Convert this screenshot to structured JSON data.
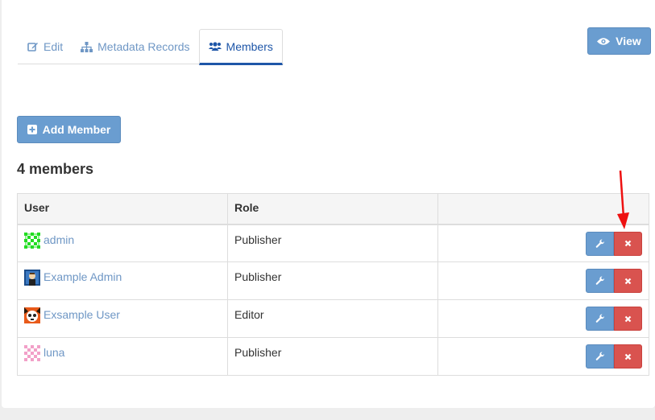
{
  "tabs": [
    {
      "label": "Edit",
      "icon": "edit-icon",
      "active": false
    },
    {
      "label": "Metadata Records",
      "icon": "sitemap-icon",
      "active": false
    },
    {
      "label": "Members",
      "icon": "users-icon",
      "active": true
    }
  ],
  "view_button": {
    "label": "View",
    "icon": "eye-icon"
  },
  "add_member_button": {
    "label": "Add Member",
    "icon": "plus-square-icon"
  },
  "member_count": "4 members",
  "table": {
    "headers": [
      "User",
      "Role",
      ""
    ],
    "rows": [
      {
        "user": "admin",
        "role": "Publisher",
        "avatar": "green-identicon"
      },
      {
        "user": "Example Admin",
        "role": "Publisher",
        "avatar": "person-avatar"
      },
      {
        "user": "Exsample User",
        "role": "Editor",
        "avatar": "panda-avatar"
      },
      {
        "user": "luna",
        "role": "Publisher",
        "avatar": "pink-identicon"
      }
    ]
  },
  "colors": {
    "primary": "#6a9dd0",
    "danger": "#d9534f",
    "link": "#6f97c5",
    "active_tab": "#1e56a8",
    "annotation_arrow": "#ee1111"
  }
}
